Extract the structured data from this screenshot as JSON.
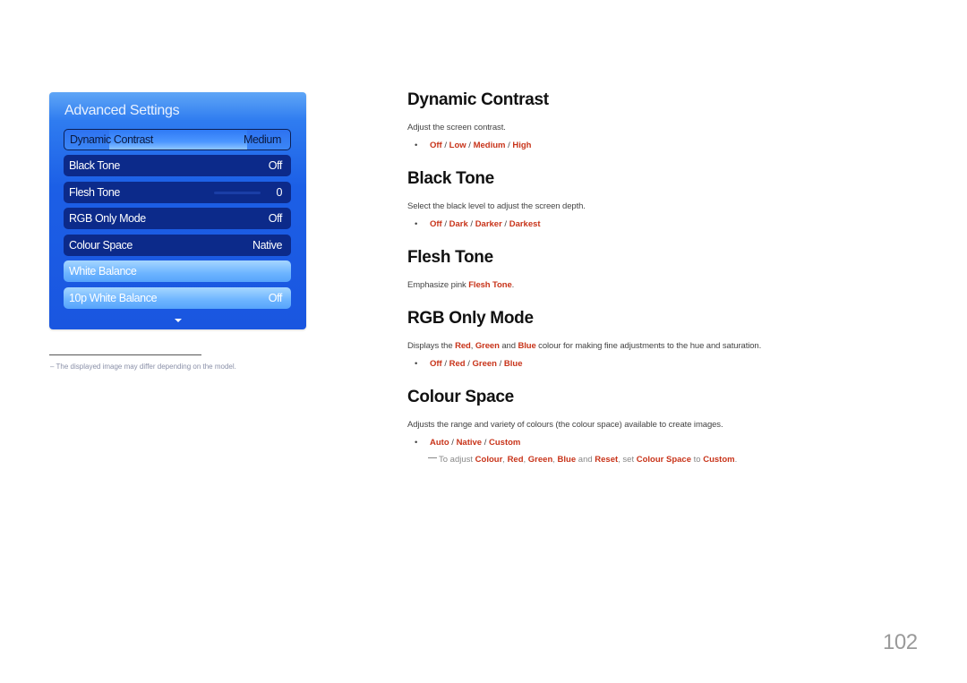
{
  "osd": {
    "title": "Advanced Settings",
    "items": [
      {
        "label": "Dynamic Contrast",
        "value": "Medium",
        "state": "selected"
      },
      {
        "label": "Black Tone",
        "value": "Off",
        "state": "normal"
      },
      {
        "label": "Flesh Tone",
        "value": "0",
        "state": "normal"
      },
      {
        "label": "RGB Only Mode",
        "value": "Off",
        "state": "normal"
      },
      {
        "label": "Colour Space",
        "value": "Native",
        "state": "normal"
      },
      {
        "label": "White Balance",
        "value": "",
        "state": "disabled"
      },
      {
        "label": "10p White Balance",
        "value": "Off",
        "state": "disabled"
      }
    ],
    "more_icon": "chevron-down-icon"
  },
  "footnote": "–  The displayed image may differ depending on the model.",
  "sections": {
    "dynamic_contrast": {
      "title": "Dynamic Contrast",
      "desc": "Adjust the screen contrast.",
      "options": [
        "Off",
        "Low",
        "Medium",
        "High"
      ]
    },
    "black_tone": {
      "title": "Black Tone",
      "desc": "Select the black level to adjust the screen depth.",
      "options": [
        "Off",
        "Dark",
        "Darker",
        "Darkest"
      ]
    },
    "flesh_tone": {
      "title": "Flesh Tone",
      "desc_prefix": "Emphasize pink ",
      "desc_hl": "Flesh Tone",
      "desc_suffix": "."
    },
    "rgb_only_mode": {
      "title": "RGB Only Mode",
      "desc_parts": [
        "Displays the ",
        "Red",
        ", ",
        "Green",
        " and ",
        "Blue",
        " colour for making fine adjustments to the hue and saturation."
      ],
      "options": [
        "Off",
        "Red",
        "Green",
        "Blue"
      ]
    },
    "colour_space": {
      "title": "Colour Space",
      "desc": "Adjusts the range and variety of colours (the colour space) available to create images.",
      "options": [
        "Auto",
        "Native",
        "Custom"
      ],
      "note_parts": [
        "To adjust ",
        "Colour",
        ", ",
        "Red",
        ", ",
        "Green",
        ", ",
        "Blue",
        " and ",
        "Reset",
        ", set ",
        "Colour Space",
        " to ",
        "Custom",
        "."
      ]
    }
  },
  "page_number": "102",
  "colors": {
    "highlight": "#c8341a",
    "osd_blue": "#1c5fe6",
    "osd_dark_row": "#0c2a8a"
  }
}
